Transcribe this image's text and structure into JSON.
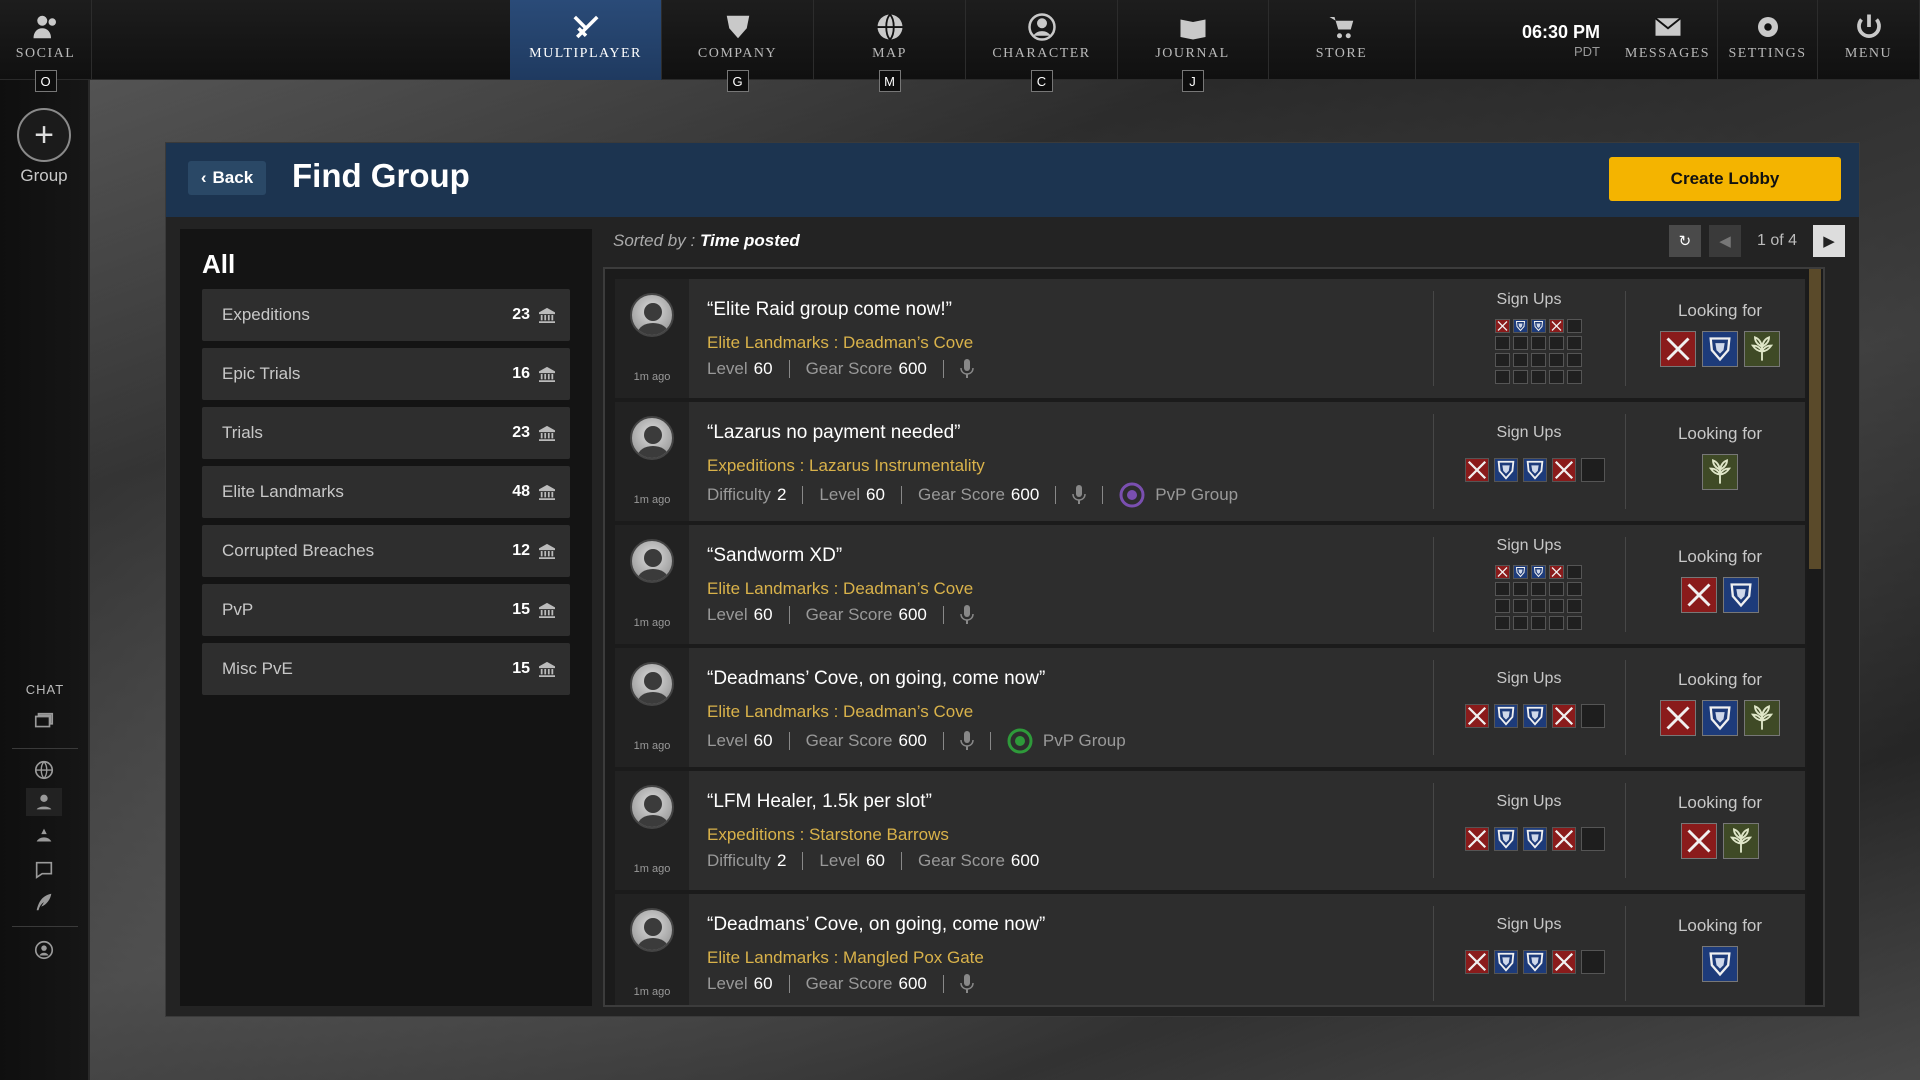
{
  "nav": {
    "social": {
      "label": "SOCIAL",
      "key": "O"
    },
    "items": [
      {
        "label": "MULTIPLAYER",
        "key": "",
        "icon": "crossed-swords-icon",
        "active": true
      },
      {
        "label": "COMPANY",
        "key": "G",
        "icon": "shield-icon",
        "active": false
      },
      {
        "label": "MAP",
        "key": "M",
        "icon": "globe-icon",
        "active": false
      },
      {
        "label": "CHARACTER",
        "key": "C",
        "icon": "person-icon",
        "active": false
      },
      {
        "label": "JOURNAL",
        "key": "J",
        "icon": "book-icon",
        "active": false
      },
      {
        "label": "STORE",
        "key": "",
        "icon": "cart-icon",
        "active": false
      }
    ],
    "clock": {
      "time": "06:30 PM",
      "zone": "PDT"
    },
    "right": [
      {
        "label": "MESSAGES",
        "icon": "envelope-icon"
      },
      {
        "label": "SETTINGS",
        "icon": "gear-icon"
      },
      {
        "label": "MENU",
        "icon": "power-icon"
      }
    ]
  },
  "rail": {
    "group_label": "Group",
    "chat_label": "CHAT"
  },
  "panel": {
    "back_label": "Back",
    "title": "Find Group",
    "create_label": "Create Lobby"
  },
  "categories": {
    "title": "All",
    "items": [
      {
        "name": "Expeditions",
        "count": "23"
      },
      {
        "name": "Epic Trials",
        "count": "16"
      },
      {
        "name": "Trials",
        "count": "23"
      },
      {
        "name": "Elite Landmarks",
        "count": "48"
      },
      {
        "name": "Corrupted Breaches",
        "count": "12"
      },
      {
        "name": "PvP",
        "count": "15"
      },
      {
        "name": "Misc PvE",
        "count": "15"
      }
    ]
  },
  "list": {
    "sorted_prefix": "Sorted by : ",
    "sorted_value": "Time posted",
    "page_text": "1 of 4",
    "signups_label": "Sign Ups",
    "looking_label": "Looking for",
    "rows": [
      {
        "title": "“Elite Raid group come now!”",
        "location": "Elite Landmarks : Deadman’s Cove",
        "ago": "1m ago",
        "meta": [
          {
            "k": "Level",
            "v": "60"
          },
          {
            "k": "Gear Score",
            "v": "600"
          }
        ],
        "mic": true,
        "pvp": "",
        "signup_style": "grid",
        "signups": [
          "dps",
          "tank",
          "tank",
          "dps",
          "empty"
        ],
        "looking": [
          "dps",
          "tank",
          "heal"
        ]
      },
      {
        "title": "“Lazarus no payment needed”",
        "location": "Expeditions : Lazarus Instrumentality",
        "ago": "1m ago",
        "meta": [
          {
            "k": "Difficulty",
            "v": "2"
          },
          {
            "k": "Level",
            "v": "60"
          },
          {
            "k": "Gear Score",
            "v": "600"
          }
        ],
        "mic": true,
        "pvp": "PvP Group",
        "pvp_color": "#7a4fb0",
        "signup_style": "slots",
        "signups": [
          "dps",
          "tank",
          "tank",
          "dps",
          "empty"
        ],
        "looking": [
          "heal"
        ]
      },
      {
        "title": "“Sandworm XD”",
        "location": "Elite Landmarks : Deadman’s Cove",
        "ago": "1m ago",
        "meta": [
          {
            "k": "Level",
            "v": "60"
          },
          {
            "k": "Gear Score",
            "v": "600"
          }
        ],
        "mic": true,
        "pvp": "",
        "signup_style": "grid",
        "signups": [
          "dps",
          "tank",
          "tank",
          "dps",
          "empty"
        ],
        "looking": [
          "dps",
          "tank"
        ]
      },
      {
        "title": "“Deadmans’ Cove, on going, come now”",
        "location": "Elite Landmarks : Deadman’s Cove",
        "ago": "1m ago",
        "meta": [
          {
            "k": "Level",
            "v": "60"
          },
          {
            "k": "Gear Score",
            "v": "600"
          }
        ],
        "mic": true,
        "pvp": "PvP Group",
        "pvp_color": "#2e9a3a",
        "signup_style": "slots",
        "signups": [
          "dps",
          "tank",
          "tank",
          "dps",
          "empty"
        ],
        "looking": [
          "dps",
          "tank",
          "heal"
        ]
      },
      {
        "title": "“LFM Healer, 1.5k per slot”",
        "location": "Expeditions : Starstone Barrows",
        "ago": "1m ago",
        "meta": [
          {
            "k": "Difficulty",
            "v": "2"
          },
          {
            "k": "Level",
            "v": "60"
          },
          {
            "k": "Gear Score",
            "v": "600"
          }
        ],
        "mic": false,
        "pvp": "",
        "signup_style": "slots",
        "signups": [
          "dps",
          "tank",
          "tank",
          "dps",
          "empty"
        ],
        "looking": [
          "dps",
          "heal"
        ]
      },
      {
        "title": "“Deadmans’ Cove, on going, come now”",
        "location": "Elite Landmarks : Mangled Pox Gate",
        "ago": "1m ago",
        "meta": [
          {
            "k": "Level",
            "v": "60"
          },
          {
            "k": "Gear Score",
            "v": "600"
          }
        ],
        "mic": true,
        "pvp": "",
        "signup_style": "slots",
        "signups": [
          "dps",
          "tank",
          "tank",
          "dps",
          "empty"
        ],
        "looking": [
          "tank"
        ]
      }
    ]
  },
  "colors": {
    "accent": "#f4b400",
    "header": "#1c3450",
    "location": "#d9b24a",
    "dps": "#8a1b1b",
    "tank": "#1d3b7a",
    "heal": "#3f4a26"
  }
}
